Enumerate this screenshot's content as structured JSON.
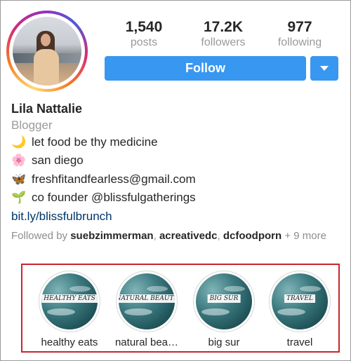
{
  "profile": {
    "name": "Lila Nattalie",
    "category": "Blogger",
    "bio": [
      {
        "icon": "crescent-moon-icon",
        "glyph": "🌙",
        "text": "let food be thy medicine"
      },
      {
        "icon": "cherry-blossom-icon",
        "glyph": "🌸",
        "text": "san diego"
      },
      {
        "icon": "butterfly-icon",
        "glyph": "🦋",
        "text": "freshfitandfearless@gmail.com"
      },
      {
        "icon": "seedling-icon",
        "glyph": "🌱",
        "text": "co founder @blissfulgatherings"
      }
    ],
    "link": "bit.ly/blissfulbrunch",
    "followed_by": {
      "prefix": "Followed by",
      "users": [
        "suebzimmerman",
        "acreativedc",
        "dcfoodporn"
      ],
      "suffix": "+ 9 more"
    }
  },
  "stats": {
    "posts": {
      "value": "1,540",
      "label": "posts"
    },
    "followers": {
      "value": "17.2K",
      "label": "followers"
    },
    "following": {
      "value": "977",
      "label": "following"
    }
  },
  "actions": {
    "follow_label": "Follow"
  },
  "highlights": [
    {
      "cover_text": "healthy eats",
      "label": "healthy eats"
    },
    {
      "cover_text": "natural beauty",
      "label": "natural bea…"
    },
    {
      "cover_text": "big sur",
      "label": "big sur"
    },
    {
      "cover_text": "travel",
      "label": "travel"
    }
  ],
  "colors": {
    "accent": "#3897f0",
    "highlight_box": "#c8252e",
    "link": "#003569",
    "muted": "#9a9a9a"
  }
}
